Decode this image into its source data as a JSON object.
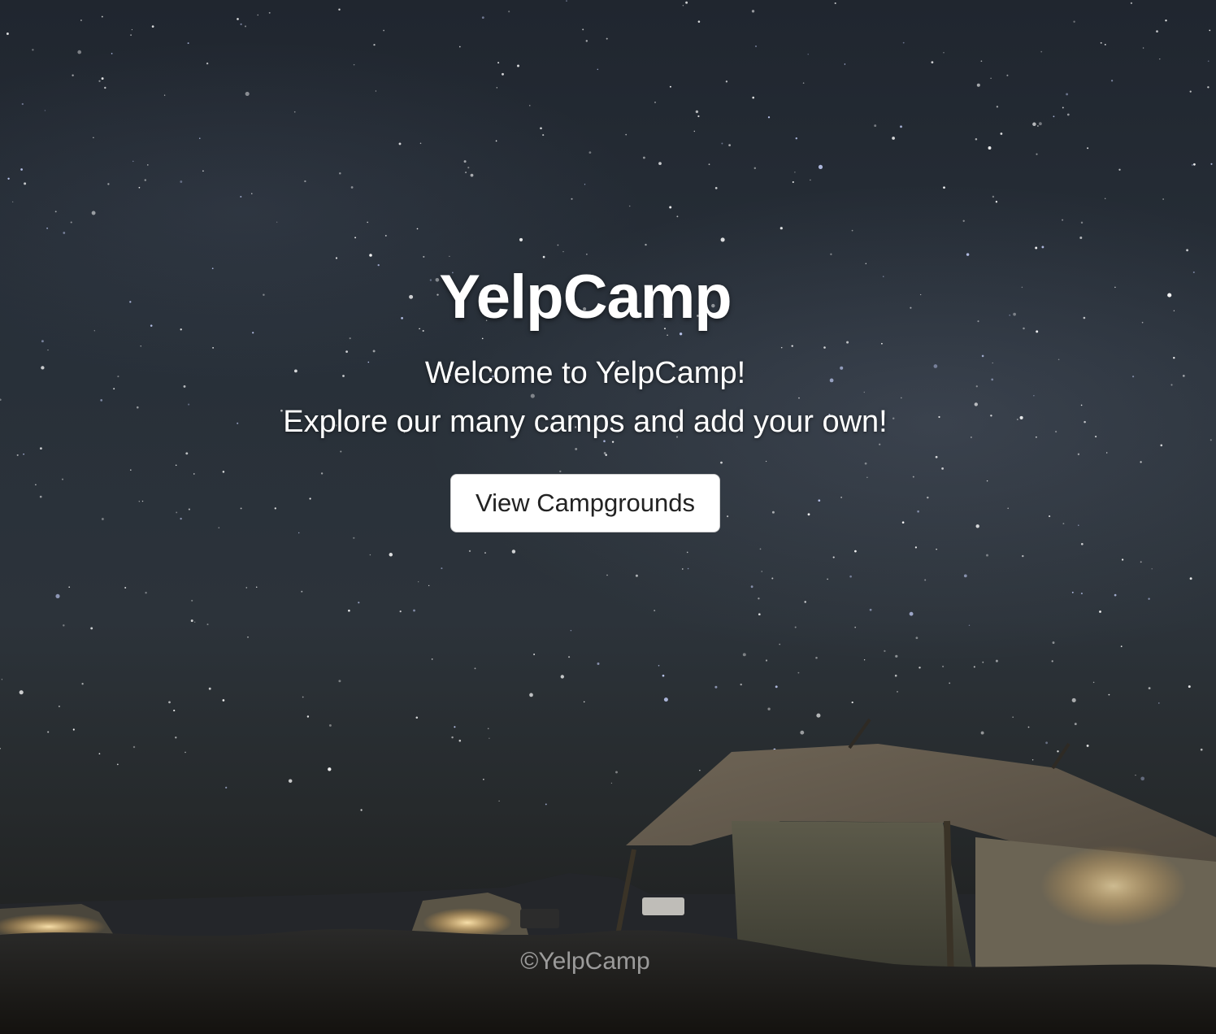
{
  "hero": {
    "title": "YelpCamp",
    "welcome": "Welcome to YelpCamp!",
    "tagline": "Explore our many camps and add your own!",
    "cta_label": "View Campgrounds"
  },
  "footer": {
    "copyright": "©YelpCamp"
  },
  "colors": {
    "sky": "#283039",
    "ground": "#1c1b19",
    "button_bg": "#ffffff",
    "button_text": "#222222",
    "title_text": "#ffffff"
  }
}
